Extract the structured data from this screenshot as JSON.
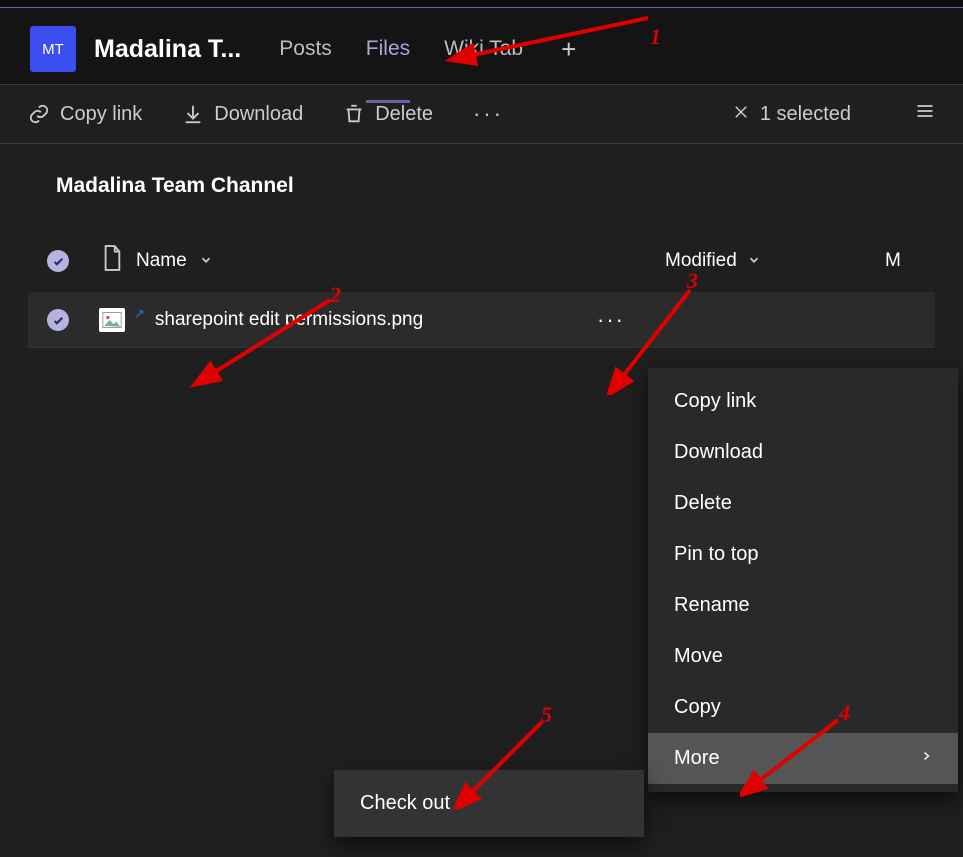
{
  "header": {
    "avatar_initials": "MT",
    "team_title": "Madalina T...",
    "tabs": {
      "posts": "Posts",
      "files": "Files",
      "wiki": "Wiki Tab"
    },
    "add_tab": "+"
  },
  "toolbar": {
    "copy_link": "Copy link",
    "download": "Download",
    "delete": "Delete",
    "more": "···",
    "selected_close": "×",
    "selected_text": "1 selected"
  },
  "content": {
    "channel_title": "Madalina Team Channel",
    "columns": {
      "name": "Name",
      "modified": "Modified",
      "modified_by": "M"
    },
    "rows": [
      {
        "file_name": "sharepoint edit permissions.png"
      }
    ]
  },
  "context_menu": {
    "items": [
      {
        "key": "copy_link",
        "label": "Copy link"
      },
      {
        "key": "download",
        "label": "Download"
      },
      {
        "key": "delete",
        "label": "Delete"
      },
      {
        "key": "pin_to_top",
        "label": "Pin to top"
      },
      {
        "key": "rename",
        "label": "Rename"
      },
      {
        "key": "move",
        "label": "Move"
      },
      {
        "key": "copy",
        "label": "Copy"
      },
      {
        "key": "more",
        "label": "More",
        "submenu": true
      }
    ]
  },
  "submenu": {
    "check_out": "Check out"
  },
  "annotations": {
    "n1": "1",
    "n2": "2",
    "n3": "3",
    "n4": "4",
    "n5": "5"
  }
}
